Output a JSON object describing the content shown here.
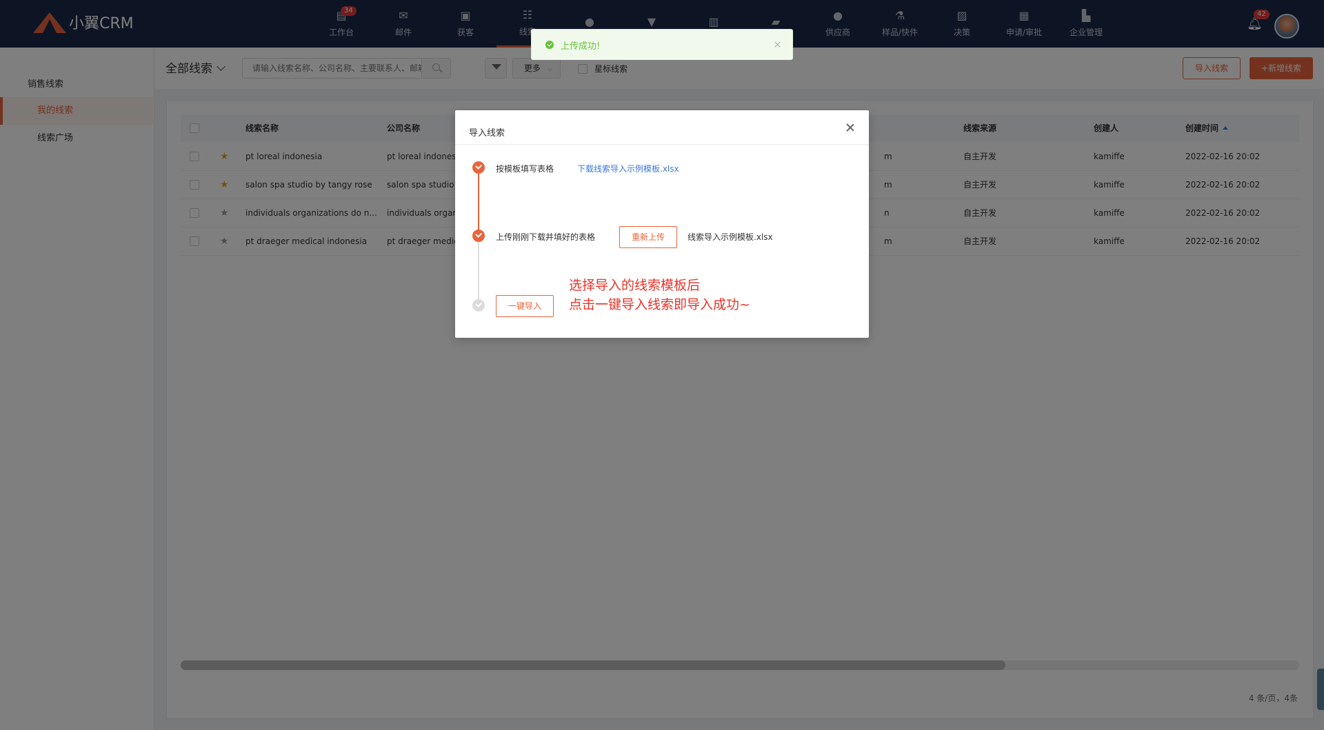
{
  "app": {
    "brand": "小翼CRM"
  },
  "nav": [
    {
      "label": "工作台",
      "icon": "dashboard-icon",
      "badge": "34",
      "glyph": "▤"
    },
    {
      "label": "邮件",
      "icon": "mail-icon",
      "badge": "",
      "glyph": "✉"
    },
    {
      "label": "获客",
      "icon": "acquire-icon",
      "badge": "",
      "glyph": "▣"
    },
    {
      "label": "线索",
      "icon": "leads-icon",
      "badge": "",
      "glyph": "☷",
      "active": true
    },
    {
      "label": "",
      "icon": "customer-icon",
      "badge": "",
      "glyph": "●"
    },
    {
      "label": "",
      "icon": "funnel-icon",
      "badge": "",
      "glyph": "▼"
    },
    {
      "label": "",
      "icon": "clipboard-icon",
      "badge": "",
      "glyph": "▥"
    },
    {
      "label": "",
      "icon": "briefcase-icon",
      "badge": "",
      "glyph": "▰"
    },
    {
      "label": "供应商",
      "icon": "supplier-icon",
      "badge": "",
      "glyph": "●"
    },
    {
      "label": "样品/快件",
      "icon": "flask-icon",
      "badge": "",
      "glyph": "⚗"
    },
    {
      "label": "决策",
      "icon": "chart-icon",
      "badge": "",
      "glyph": "▨"
    },
    {
      "label": "申请/审批",
      "icon": "approval-icon",
      "badge": "",
      "glyph": "▦"
    },
    {
      "label": "企业管理",
      "icon": "building-icon",
      "badge": "",
      "glyph": "▙"
    }
  ],
  "header": {
    "bell_badge": "42"
  },
  "sidebar": {
    "title": "销售线索",
    "items": [
      {
        "label": "我的线索",
        "active": true
      },
      {
        "label": "线索广场",
        "active": false
      }
    ]
  },
  "toolbar": {
    "title": "全部线索",
    "search_placeholder": "请输入线索名称、公司名称、主要联系人、邮箱",
    "more_label": "更多",
    "star_label": "星标线索",
    "import_label": "导入线索",
    "new_label": "+新增线索"
  },
  "table": {
    "columns": {
      "name": "线索名称",
      "company": "公司名称",
      "source": "线索来源",
      "creator": "创建人",
      "created": "创建时间"
    },
    "rows": [
      {
        "starred": true,
        "name": "pt loreal indonesia",
        "company": "pt loreal indonesi",
        "hidden_tail": "m",
        "source": "自主开发",
        "creator": "kamiffe",
        "created": "2022-02-16 20:02"
      },
      {
        "starred": true,
        "name": "salon spa studio by tangy rose",
        "company": "salon spa studio l",
        "hidden_tail": "m",
        "source": "自主开发",
        "creator": "kamiffe",
        "created": "2022-02-16 20:02"
      },
      {
        "starred": false,
        "name": "individuals organizations do n...",
        "company": "individuals organi",
        "hidden_tail": "n",
        "source": "自主开发",
        "creator": "kamiffe",
        "created": "2022-02-16 20:02"
      },
      {
        "starred": false,
        "name": "pt draeger medical indonesia",
        "company": "pt draeger medica",
        "hidden_tail": "m",
        "source": "自主开发",
        "creator": "kamiffe",
        "created": "2022-02-16 20:02"
      }
    ],
    "pager": "4 条/页，4条"
  },
  "modal": {
    "title": "导入线索",
    "step1_text": "按模板填写表格",
    "step1_link": "下载线索导入示例模板.xlsx",
    "step2_text": "上传刚刚下载并填好的表格",
    "step2_button": "重新上传",
    "step2_file": "线索导入示例模板.xlsx",
    "step3_button": "一键导入",
    "annotation_line1": "选择导入的线索模板后",
    "annotation_line2": "点击一键导入线索即导入成功~"
  },
  "toast": {
    "message": "上传成功!"
  },
  "colors": {
    "accent": "#e8643c",
    "nav_bg": "#1b2a4a",
    "success": "#67c23a",
    "link": "#3c78d8",
    "annotation": "#e8342a"
  }
}
